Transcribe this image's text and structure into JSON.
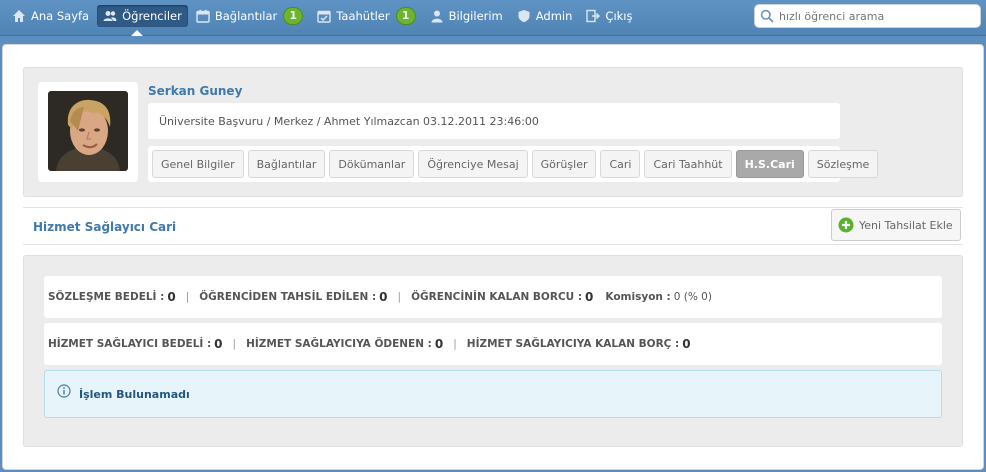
{
  "nav": {
    "items": [
      {
        "label": "Ana Sayfa",
        "icon": "home-icon"
      },
      {
        "label": "Öğrenciler",
        "icon": "users-icon",
        "active": true
      },
      {
        "label": "Bağlantılar",
        "icon": "calendar-icon",
        "badge": "1"
      },
      {
        "label": "Taahütler",
        "icon": "calendar-check-icon",
        "badge": "1"
      },
      {
        "label": "Bilgilerim",
        "icon": "user-icon"
      },
      {
        "label": "Admin",
        "icon": "shield-icon"
      },
      {
        "label": "Çıkış",
        "icon": "logout-icon"
      }
    ]
  },
  "search": {
    "placeholder": "hızlı öğrenci arama",
    "value": ""
  },
  "profile": {
    "name": "Serkan Guney",
    "info": "Üniversite Başvuru / Merkez / Ahmet Yılmazcan 03.12.2011 23:46:00",
    "tabs": [
      {
        "label": "Genel Bilgiler"
      },
      {
        "label": "Bağlantılar"
      },
      {
        "label": "Dökümanlar"
      },
      {
        "label": "Öğrenciye Mesaj"
      },
      {
        "label": "Görüşler"
      },
      {
        "label": "Cari"
      },
      {
        "label": "Cari Taahhüt"
      },
      {
        "label": "H.S.Cari",
        "active": true
      },
      {
        "label": "Sözleşme"
      }
    ]
  },
  "section": {
    "title": "Hizmet Sağlayıcı Cari",
    "add_button": "Yeni Tahsilat Ekle"
  },
  "summary": {
    "row1": {
      "contract_label": "SÖZLEŞME BEDELİ :",
      "contract_value": "0",
      "collected_label": "ÖĞRENCİDEN TAHSİL EDİLEN :",
      "collected_value": "0",
      "remaining_label": "ÖĞRENCİNİN KALAN BORCU :",
      "remaining_value": "0",
      "commission_label": "Komisyon :",
      "commission_value": "0 (% 0)"
    },
    "row2": {
      "provider_fee_label": "HİZMET SAĞLAYICI BEDELİ :",
      "provider_fee_value": "0",
      "paid_label": "HİZMET SAĞLAYICIYA ÖDENEN :",
      "paid_value": "0",
      "provider_remaining_label": "HİZMET SAĞLAYICIYA KALAN BORÇ :",
      "provider_remaining_value": "0"
    }
  },
  "alert": {
    "message": "İşlem Bulunamadı"
  },
  "colors": {
    "nav_bg": "#5089bb",
    "accent_link": "#3f79ad",
    "badge_green": "#6bb52f",
    "active_tab": "#a9a9a9"
  }
}
